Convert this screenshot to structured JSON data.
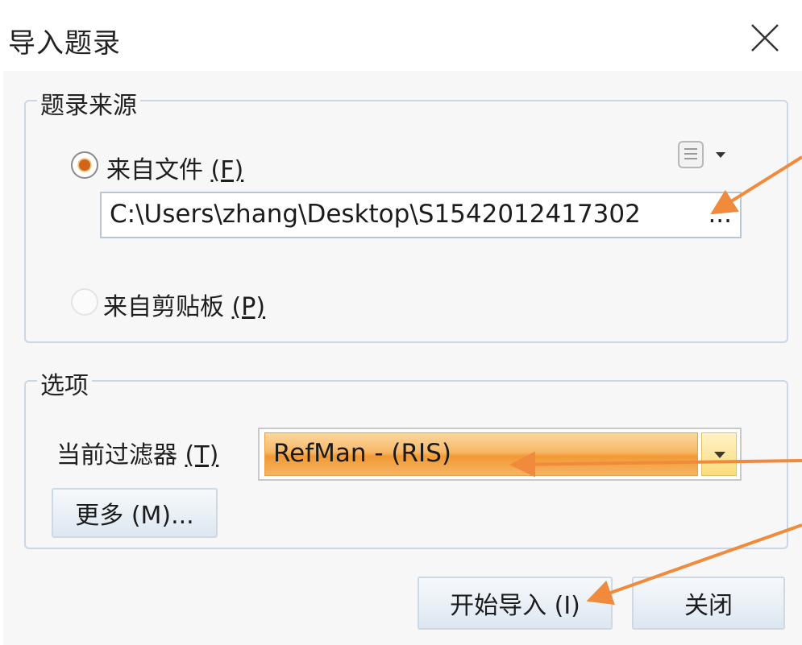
{
  "dialog": {
    "title": "导入题录",
    "close_icon": "close-icon"
  },
  "source_group": {
    "legend": "题录来源",
    "from_file": {
      "label": "来自文件",
      "accelerator": "(F)",
      "selected": true
    },
    "file_path": {
      "value": "C:\\Users\\zhang\\Desktop\\S1542012417302",
      "ellipsis": "..."
    },
    "from_clipboard": {
      "label": "来自剪贴板",
      "accelerator": "(P)",
      "selected": false
    },
    "file_menu_icon": "document-menu-icon"
  },
  "options_group": {
    "legend": "选项",
    "filter_label": "当前过滤器",
    "filter_accelerator": "(T)",
    "filter_value": "RefMan - (RIS)",
    "more_button": "更多 (M)..."
  },
  "footer": {
    "import_button": "开始导入 (I)",
    "close_button": "关闭"
  },
  "colors": {
    "accent_orange": "#f29a34",
    "annotation_arrow": "#f08a3c",
    "group_border": "#c9d7e6"
  }
}
